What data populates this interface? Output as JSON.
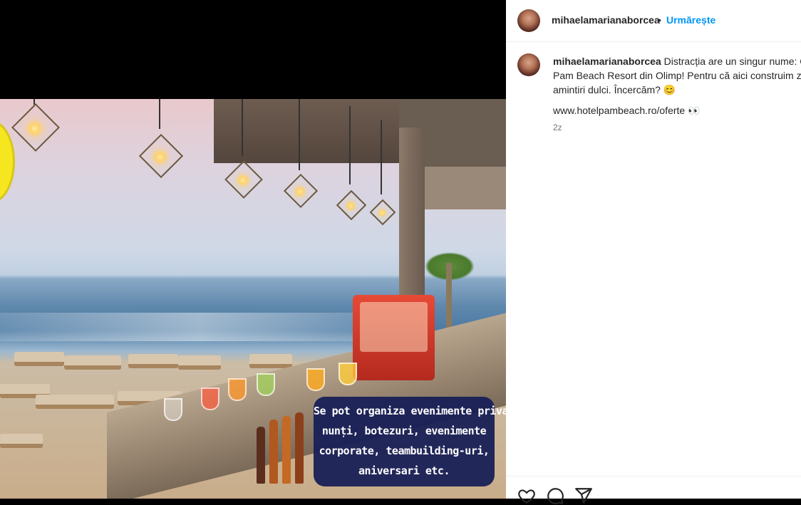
{
  "post": {
    "image_caption_lines": [
      "Se pot organiza evenimente private:",
      "nunți, botezuri, evenimente",
      "corporate, teambuilding-uri,",
      "aniversari etc."
    ]
  },
  "header": {
    "username": "mihaelamarianaborcea",
    "separator": "•",
    "follow_label": "Urmărește"
  },
  "comment": {
    "username": "mihaelamarianaborcea",
    "line1": " Distracția are un singur nume: Co",
    "line2": "Pam Beach Resort din Olimp! Pentru că aici construim zâr",
    "line3": "amintiri dulci. Încercăm? 😊",
    "link": "www.hotelpambeach.ro/oferte 👀",
    "time": "2z"
  },
  "icons": {
    "like": "heart-icon",
    "comment": "comment-icon",
    "share": "share-icon"
  },
  "colors": {
    "follow": "#0095f6",
    "caption_box": "#182056"
  }
}
